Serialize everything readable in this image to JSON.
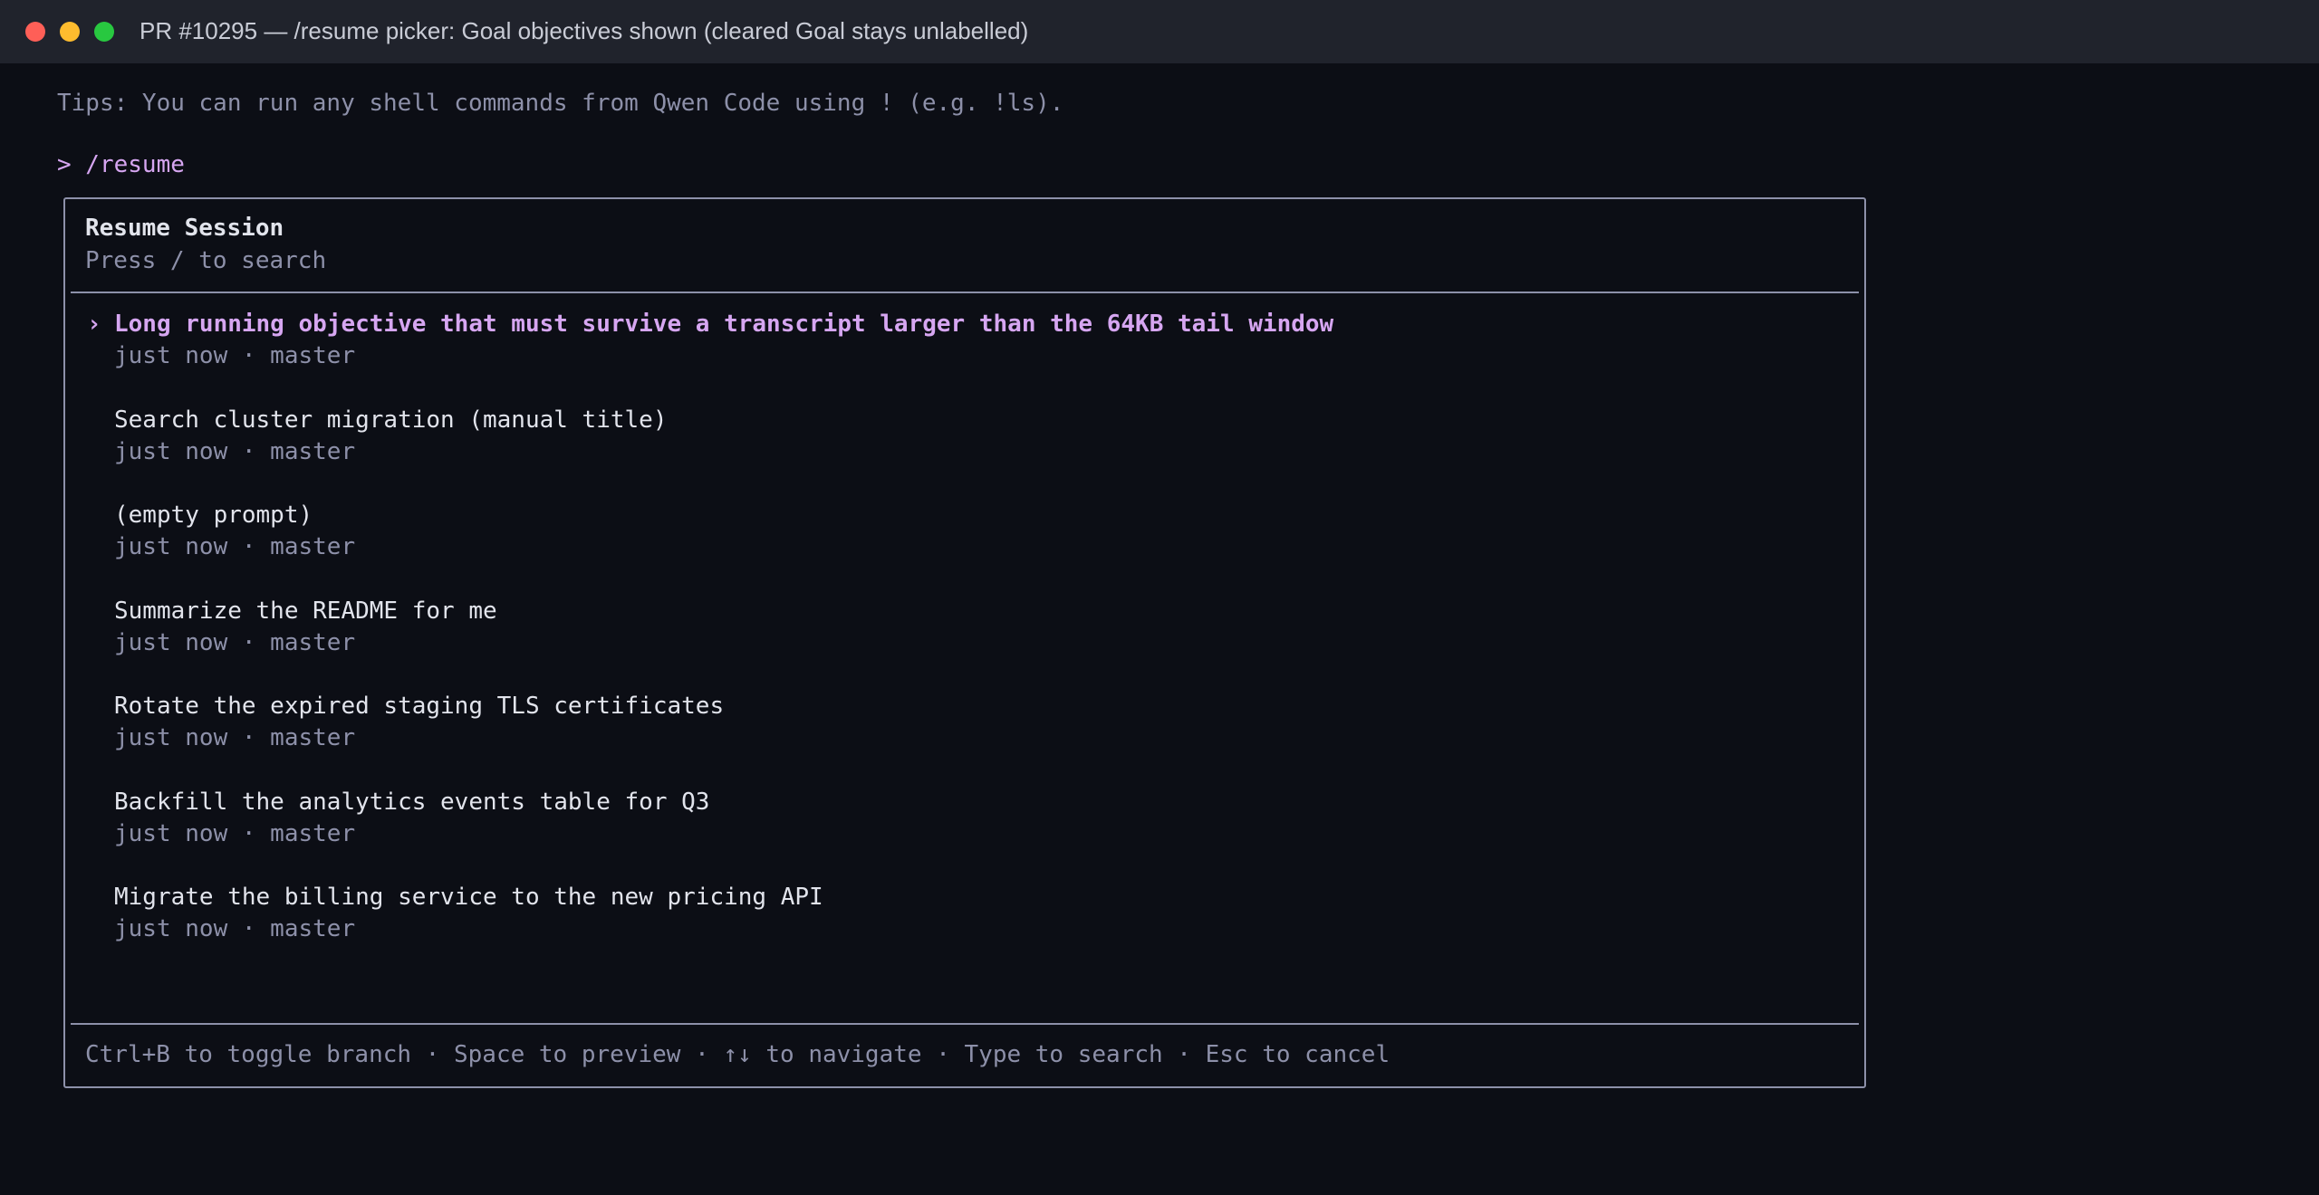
{
  "window": {
    "title": "PR #10295 — /resume picker: Goal objectives shown (cleared Goal stays unlabelled)"
  },
  "terminal": {
    "tips": "Tips: You can run any shell commands from Qwen Code using ! (e.g. !ls).",
    "prompt": "> /resume"
  },
  "picker": {
    "title": "Resume Session",
    "hint": "Press / to search",
    "cursor": "›",
    "sessions": [
      {
        "title": "Long running objective that must survive a transcript larger than the 64KB tail window",
        "meta": "just now · master",
        "selected": true
      },
      {
        "title": "Search cluster migration (manual title)",
        "meta": "just now · master",
        "selected": false
      },
      {
        "title": "(empty prompt)",
        "meta": "just now · master",
        "selected": false
      },
      {
        "title": "Summarize the README for me",
        "meta": "just now · master",
        "selected": false
      },
      {
        "title": "Rotate the expired staging TLS certificates",
        "meta": "just now · master",
        "selected": false
      },
      {
        "title": "Backfill the analytics events table for Q3",
        "meta": "just now · master",
        "selected": false
      },
      {
        "title": "Migrate the billing service to the new pricing API",
        "meta": "just now · master",
        "selected": false
      }
    ],
    "footer": "Ctrl+B to toggle branch · Space to preview · ↑↓ to navigate · Type to search · Esc to cancel"
  },
  "colors": {
    "accent": "#d6a6f1",
    "muted": "#8d90a9",
    "background": "#0c0e15"
  }
}
